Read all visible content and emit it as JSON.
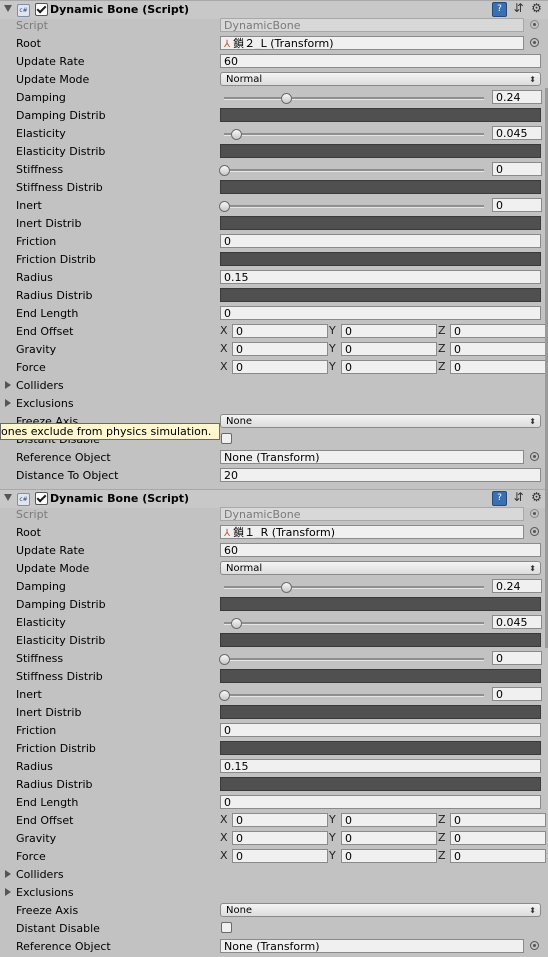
{
  "components": [
    {
      "title": "Dynamic Bone (Script)",
      "script_label": "Script",
      "script_value": "DynamicBone",
      "root_label": "Root",
      "root_value": "鎖２_L (Transform)",
      "update_rate_label": "Update Rate",
      "update_rate_value": "60",
      "update_mode_label": "Update Mode",
      "update_mode_value": "Normal",
      "damping_label": "Damping",
      "damping_value": "0.24",
      "damping_distrib_label": "Damping Distrib",
      "elasticity_label": "Elasticity",
      "elasticity_value": "0.045",
      "elasticity_distrib_label": "Elasticity Distrib",
      "stiffness_label": "Stiffness",
      "stiffness_value": "0",
      "stiffness_distrib_label": "Stiffness Distrib",
      "inert_label": "Inert",
      "inert_value": "0",
      "inert_distrib_label": "Inert Distrib",
      "friction_label": "Friction",
      "friction_value": "0",
      "friction_distrib_label": "Friction Distrib",
      "radius_label": "Radius",
      "radius_value": "0.15",
      "radius_distrib_label": "Radius Distrib",
      "end_length_label": "End Length",
      "end_length_value": "0",
      "end_offset_label": "End Offset",
      "end_offset": {
        "x": "0",
        "y": "0",
        "z": "0"
      },
      "gravity_label": "Gravity",
      "gravity": {
        "x": "0",
        "y": "0",
        "z": "0"
      },
      "force_label": "Force",
      "force": {
        "x": "0",
        "y": "0",
        "z": "0"
      },
      "colliders_label": "Colliders",
      "exclusions_label": "Exclusions",
      "freeze_axis_label": "Freeze Axis",
      "freeze_axis_value": "None",
      "distant_disable_label": "Distant Disable",
      "reference_object_label": "Reference Object",
      "reference_object_value": "None (Transform)",
      "distance_to_object_label": "Distance To Object",
      "distance_to_object_value": "20"
    },
    {
      "title": "Dynamic Bone (Script)",
      "script_label": "Script",
      "script_value": "DynamicBone",
      "root_label": "Root",
      "root_value": "鎖１_R (Transform)",
      "update_rate_label": "Update Rate",
      "update_rate_value": "60",
      "update_mode_label": "Update Mode",
      "update_mode_value": "Normal",
      "damping_label": "Damping",
      "damping_value": "0.24",
      "damping_distrib_label": "Damping Distrib",
      "elasticity_label": "Elasticity",
      "elasticity_value": "0.045",
      "elasticity_distrib_label": "Elasticity Distrib",
      "stiffness_label": "Stiffness",
      "stiffness_value": "0",
      "stiffness_distrib_label": "Stiffness Distrib",
      "inert_label": "Inert",
      "inert_value": "0",
      "inert_distrib_label": "Inert Distrib",
      "friction_label": "Friction",
      "friction_value": "0",
      "friction_distrib_label": "Friction Distrib",
      "radius_label": "Radius",
      "radius_value": "0.15",
      "radius_distrib_label": "Radius Distrib",
      "end_length_label": "End Length",
      "end_length_value": "0",
      "end_offset_label": "End Offset",
      "end_offset": {
        "x": "0",
        "y": "0",
        "z": "0"
      },
      "gravity_label": "Gravity",
      "gravity": {
        "x": "0",
        "y": "0",
        "z": "0"
      },
      "force_label": "Force",
      "force": {
        "x": "0",
        "y": "0",
        "z": "0"
      },
      "colliders_label": "Colliders",
      "exclusions_label": "Exclusions",
      "freeze_axis_label": "Freeze Axis",
      "freeze_axis_value": "None",
      "distant_disable_label": "Distant Disable",
      "reference_object_label": "Reference Object",
      "reference_object_value": "None (Transform)"
    }
  ],
  "axis_labels": {
    "x": "X",
    "y": "Y",
    "z": "Z"
  },
  "sliders": {
    "damping": 0.24,
    "elasticity": 0.045,
    "stiffness": 0,
    "inert": 0
  },
  "tooltip": "ones exclude from physics simulation.",
  "colors": {
    "panel": "#c2c2c2",
    "curve": "#505050",
    "tooltip_bg": "#fff7d0",
    "link_icon": "#3a6fb0"
  }
}
